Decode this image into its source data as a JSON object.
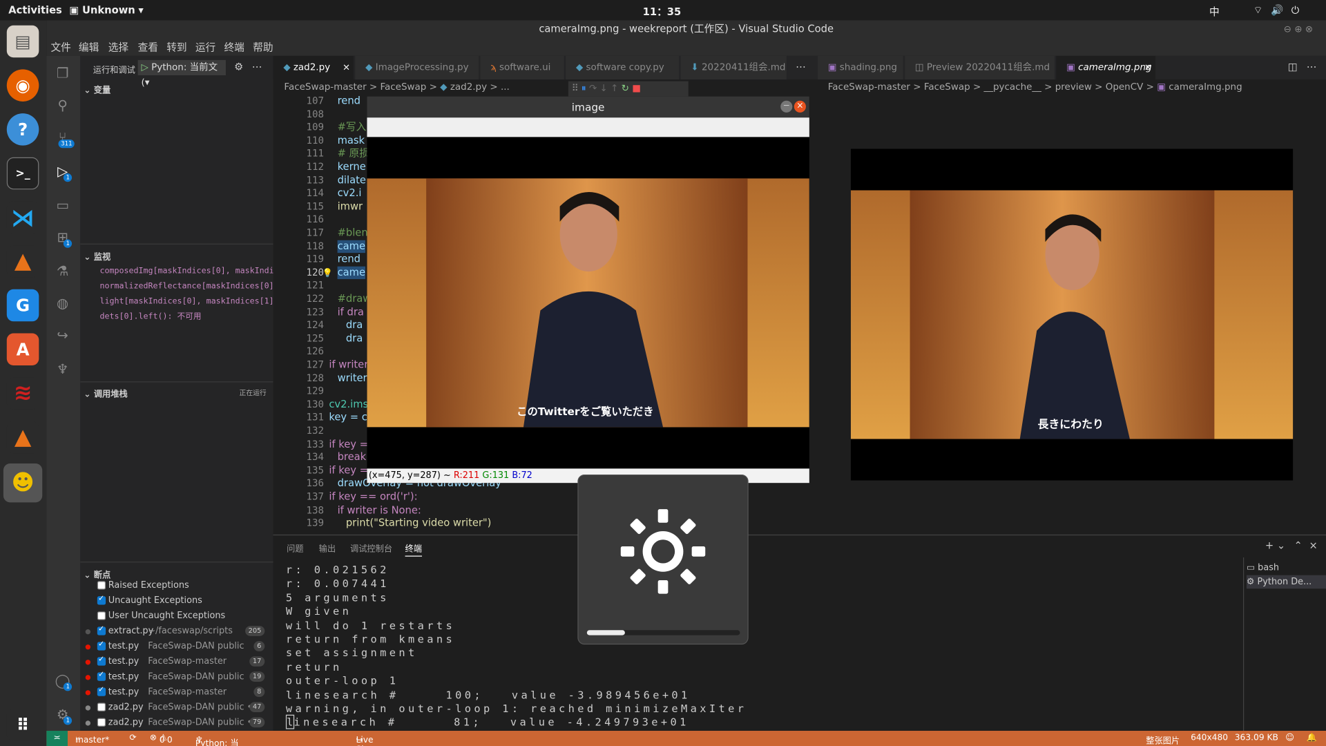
{
  "topbar": {
    "activities": "Activities",
    "app": "Unknown",
    "clock": "11：35",
    "ime": "中"
  },
  "vscode": {
    "title": "cameraImg.png - weekreport (工作区) - Visual Studio Code",
    "menu": [
      "文件",
      "编辑",
      "选择",
      "查看",
      "转到",
      "运行",
      "终端",
      "帮助"
    ],
    "activity_badges": {
      "scm": "311",
      "debug": "1",
      "ext": "1",
      "account": "1",
      "settings": "1"
    },
    "run": {
      "label": "运行和调试",
      "config": "Python: 当前文(▾"
    },
    "sections": {
      "variables": "变量",
      "watch": "监视",
      "callstack": "调用堆栈",
      "callstack_state": "正在运行",
      "breakpoints": "断点"
    },
    "watch": [
      "composedImg[maskIndices[0], maskIndi",
      "normalizedReflectance[maskIndices[0]",
      "light[maskIndices[0], maskIndices[1]",
      "dets[0].left(): 不可用"
    ],
    "breakpoints": [
      {
        "label": "Raised Exceptions",
        "checked": false
      },
      {
        "label": "Uncaught Exceptions",
        "checked": true
      },
      {
        "label": "User Uncaught Exceptions",
        "checked": false
      },
      {
        "label": "extract.py",
        "path": "~/faceswap/scripts",
        "count": "205",
        "checked": true,
        "dot": "#555"
      },
      {
        "label": "test.py",
        "path": "FaceSwap-DAN public",
        "count": "6",
        "checked": true,
        "dot": "#e51400"
      },
      {
        "label": "test.py",
        "path": "FaceSwap-master",
        "count": "17",
        "checked": true,
        "dot": "#e51400"
      },
      {
        "label": "test.py",
        "path": "FaceSwap-DAN public",
        "count": "19",
        "checked": true,
        "dot": "#e51400"
      },
      {
        "label": "test.py",
        "path": "FaceSwap-master",
        "count": "8",
        "checked": true,
        "dot": "#e51400"
      },
      {
        "label": "zad2.py",
        "path": "FaceSwap-DAN public •...",
        "count": "47",
        "checked": false,
        "dot": "#888"
      },
      {
        "label": "zad2.py",
        "path": "FaceSwap-DAN public •...",
        "count": "79",
        "checked": false,
        "dot": "#888"
      }
    ],
    "tabs_left": [
      "zad2.py",
      "ImageProcessing.py",
      "software.ui",
      "software copy.py",
      "20220411组会.md"
    ],
    "tabs_right": [
      "shading.png",
      "Preview 20220411组会.md",
      "cameraImg.png"
    ],
    "crumbs_left": [
      "FaceSwap-master",
      ">",
      "FaceSwap",
      ">",
      "zad2.py",
      ">",
      "..."
    ],
    "crumbs_right": [
      "FaceSwap-master",
      ">",
      "FaceSwap",
      ">",
      "__pycache__",
      ">",
      "preview",
      ">",
      "OpenCV",
      ">",
      "cameraImg.png"
    ],
    "line_numbers": [
      "107",
      "108",
      "109",
      "110",
      "111",
      "112",
      "113",
      "114",
      "115",
      "116",
      "117",
      "118",
      "119",
      "120",
      "121",
      "122",
      "123",
      "124",
      "125",
      "126",
      "127",
      "128",
      "129",
      "130",
      "131",
      "132",
      "133",
      "134",
      "135",
      "136",
      "137",
      "138",
      "139"
    ],
    "code": [
      {
        "t": "rend",
        "c": "#9cdcfe",
        "i": 1
      },
      {
        "t": "",
        "c": "#ccc",
        "i": 0
      },
      {
        "t": "#写入",
        "c": "#6a9955",
        "i": 1
      },
      {
        "t": "mask",
        "c": "#9cdcfe",
        "i": 1
      },
      {
        "t": "# 原损",
        "c": "#6a9955",
        "i": 1
      },
      {
        "t": "kerne",
        "c": "#9cdcfe",
        "i": 1
      },
      {
        "t": "dilate",
        "c": "#9cdcfe",
        "i": 1
      },
      {
        "t": "cv2.i",
        "c": "#9cdcfe",
        "i": 1
      },
      {
        "t": "imwr",
        "c": "#dcdcaa",
        "i": 1
      },
      {
        "t": "",
        "c": "#ccc",
        "i": 0
      },
      {
        "t": "#blen",
        "c": "#6a9955",
        "i": 1
      },
      {
        "t": "came",
        "c": "#9cdcfe",
        "i": 1
      },
      {
        "t": "rend",
        "c": "#9cdcfe",
        "i": 1
      },
      {
        "t": "came",
        "c": "#9cdcfe",
        "i": 1
      },
      {
        "t": "",
        "c": "#ccc",
        "i": 0
      },
      {
        "t": "#draw",
        "c": "#6a9955",
        "i": 1
      },
      {
        "t": "if dra",
        "c": "#c586c0",
        "i": 1
      },
      {
        "t": "dra",
        "c": "#9cdcfe",
        "i": 2
      },
      {
        "t": "dra",
        "c": "#9cdcfe",
        "i": 2
      },
      {
        "t": "",
        "c": "#ccc",
        "i": 0
      },
      {
        "t": "if writer i",
        "c": "#c586c0",
        "i": 0
      },
      {
        "t": "writer.w",
        "c": "#9cdcfe",
        "i": 1
      },
      {
        "t": "",
        "c": "#ccc",
        "i": 0
      },
      {
        "t": "cv2.imsh",
        "c": "#4ec9b0",
        "i": 0
      },
      {
        "t": "key = cv2",
        "c": "#9cdcfe",
        "i": 0
      },
      {
        "t": "",
        "c": "#ccc",
        "i": 0
      },
      {
        "t": "if key ==",
        "c": "#c586c0",
        "i": 0
      },
      {
        "t": "break",
        "c": "#c586c0",
        "i": 1
      },
      {
        "t": "if key ==",
        "c": "#c586c0",
        "i": 0
      },
      {
        "t": "drawOverlay = not drawOverlay",
        "c": "#9cdcfe",
        "i": 1
      },
      {
        "t": "if key == ord('r'):",
        "c": "#c586c0",
        "i": 0
      },
      {
        "t": "if writer is None:",
        "c": "#c586c0",
        "i": 1
      },
      {
        "t": "print(\"Starting video writer\")",
        "c": "#dcdcaa",
        "i": 2
      }
    ],
    "cv_window": {
      "title": "image",
      "subtitle": "このTwitterをご覧いただき",
      "pixel_info": "(x=475, y=287) ~ ",
      "r": "R:211",
      "g": "G:131",
      "b": "B:72"
    },
    "preview_subtitle": "長きにわたり",
    "panel_tabs": [
      "问题",
      "输出",
      "调试控制台",
      "终端"
    ],
    "terminal": [
      "r: 0.021562",
      "r: 0.007441",
      "5 arguments",
      "W given",
      "will do 1 restarts",
      "return from kmeans",
      "set assignment",
      "return",
      "outer-loop 1",
      "linesearch #     100;   value -3.989456e+01",
      "warning, in outer-loop 1: reached minimizeMaxIter",
      "inesearch #      81;   value -4.249793e+01"
    ],
    "term_list": [
      "bash",
      "Python De..."
    ],
    "brightness_level": 0.25,
    "status": {
      "branch": "master*",
      "errors": "0",
      "warnings": "0",
      "python": "Python: 当前文件 (FaceSwap-master)",
      "liveshare": "Live Share",
      "img_label": "整张图片",
      "dims": "640x480",
      "size": "363.09 KB"
    }
  },
  "colors": {
    "status_bar": "#cc6633",
    "accent": "#0e7ad1"
  }
}
